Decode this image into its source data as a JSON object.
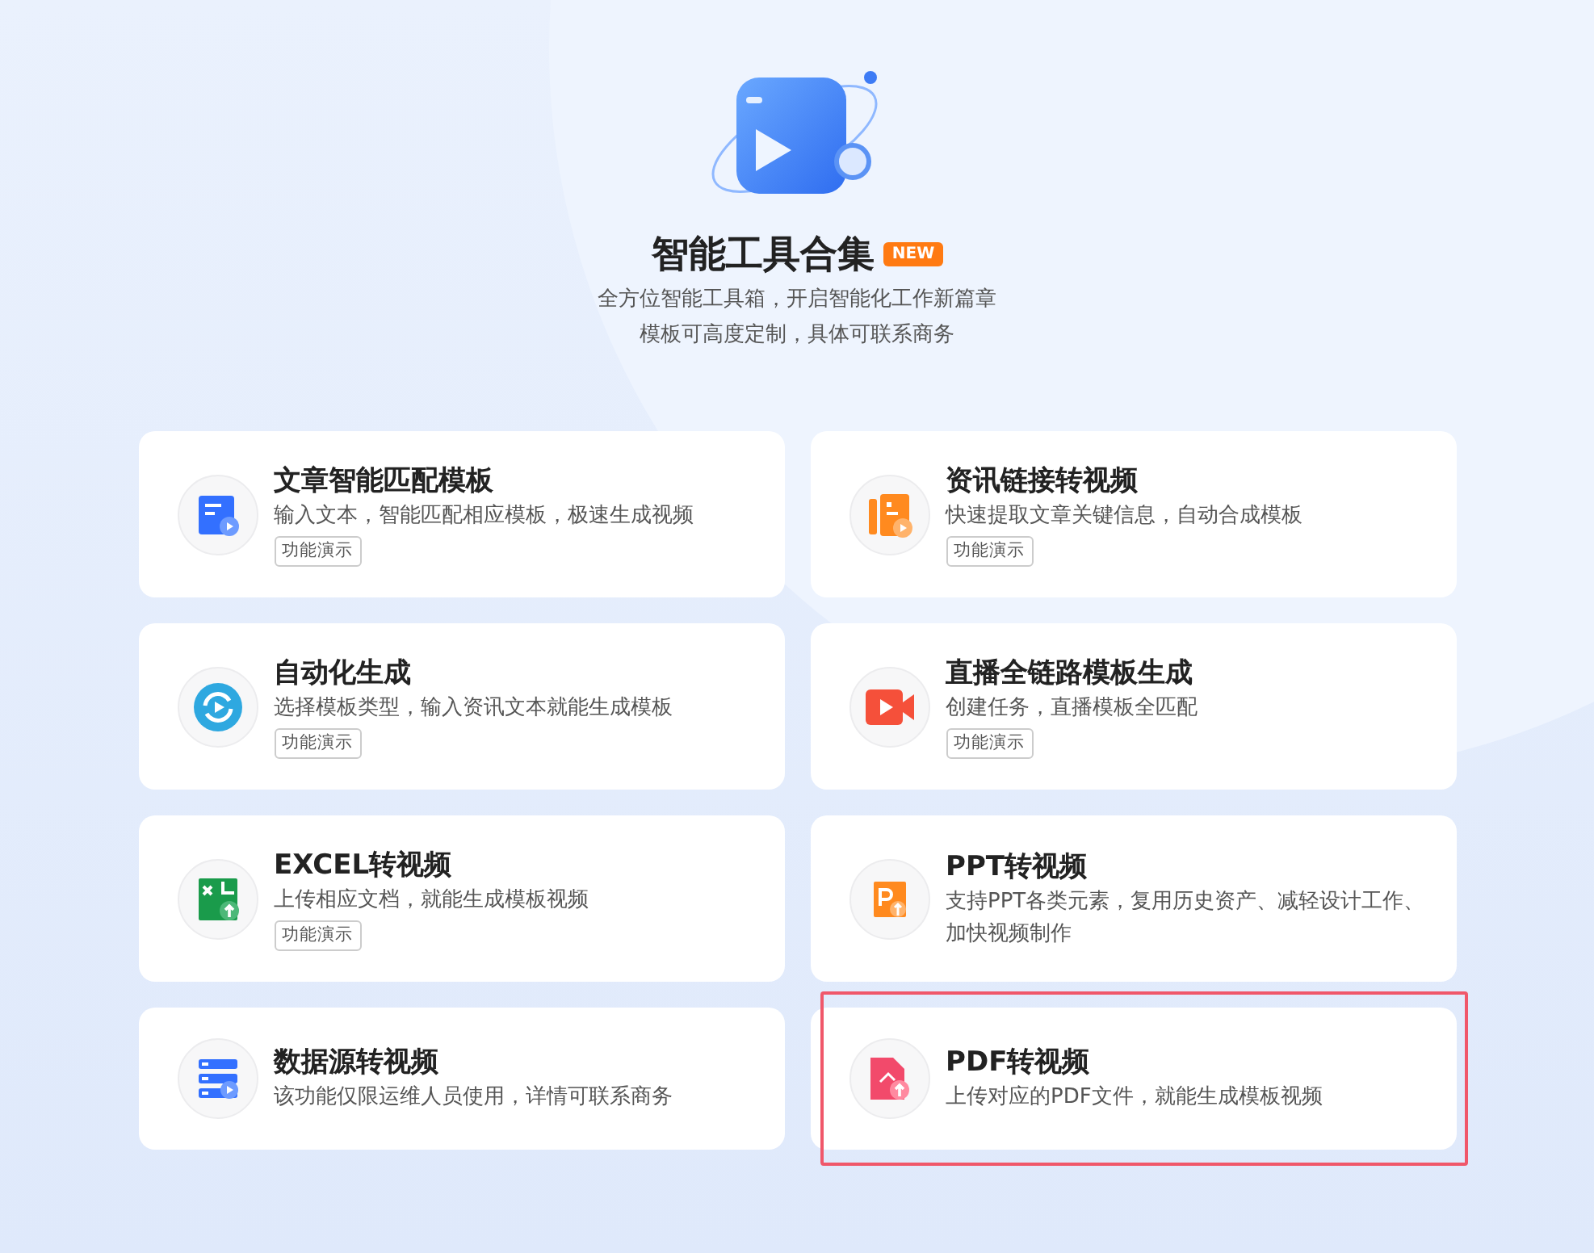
{
  "header": {
    "title": "智能工具合集",
    "badge": "NEW",
    "subtitle_lines": [
      "全方位智能工具箱，开启智能化工作新篇章",
      "模板可高度定制，具体可联系商务"
    ]
  },
  "tools": [
    {
      "kind": "document",
      "title": "文章智能匹配模板",
      "description": "输入文本，智能匹配相应模板，极速生成视频",
      "demo_label": "功能演示",
      "highlighted": false
    },
    {
      "kind": "article",
      "title": "资讯链接转视频",
      "description": "快速提取文章关键信息，自动合成模板",
      "demo_label": "功能演示",
      "highlighted": false
    },
    {
      "kind": "refresh",
      "title": "自动化生成",
      "description": "选择模板类型，输入资讯文本就能生成模板",
      "demo_label": "功能演示",
      "highlighted": false
    },
    {
      "kind": "camera",
      "title": "直播全链路模板生成",
      "description": "创建任务，直播模板全匹配",
      "demo_label": "功能演示",
      "highlighted": false
    },
    {
      "kind": "excel",
      "title": "EXCEL转视频",
      "description": "上传相应文档，就能生成模板视频",
      "demo_label": "功能演示",
      "highlighted": false
    },
    {
      "kind": "ppt",
      "title": "PPT转视频",
      "description": "支持PPT各类元素，复用历史资产、减轻设计工作、加快视频制作",
      "highlighted": false
    },
    {
      "kind": "database",
      "title": "数据源转视频",
      "description": "该功能仅限运维人员使用，详情可联系商务",
      "highlighted": false
    },
    {
      "kind": "pdf",
      "title": "PDF转视频",
      "description": "上传对应的PDF文件，就能生成模板视频",
      "highlighted": true
    }
  ]
}
